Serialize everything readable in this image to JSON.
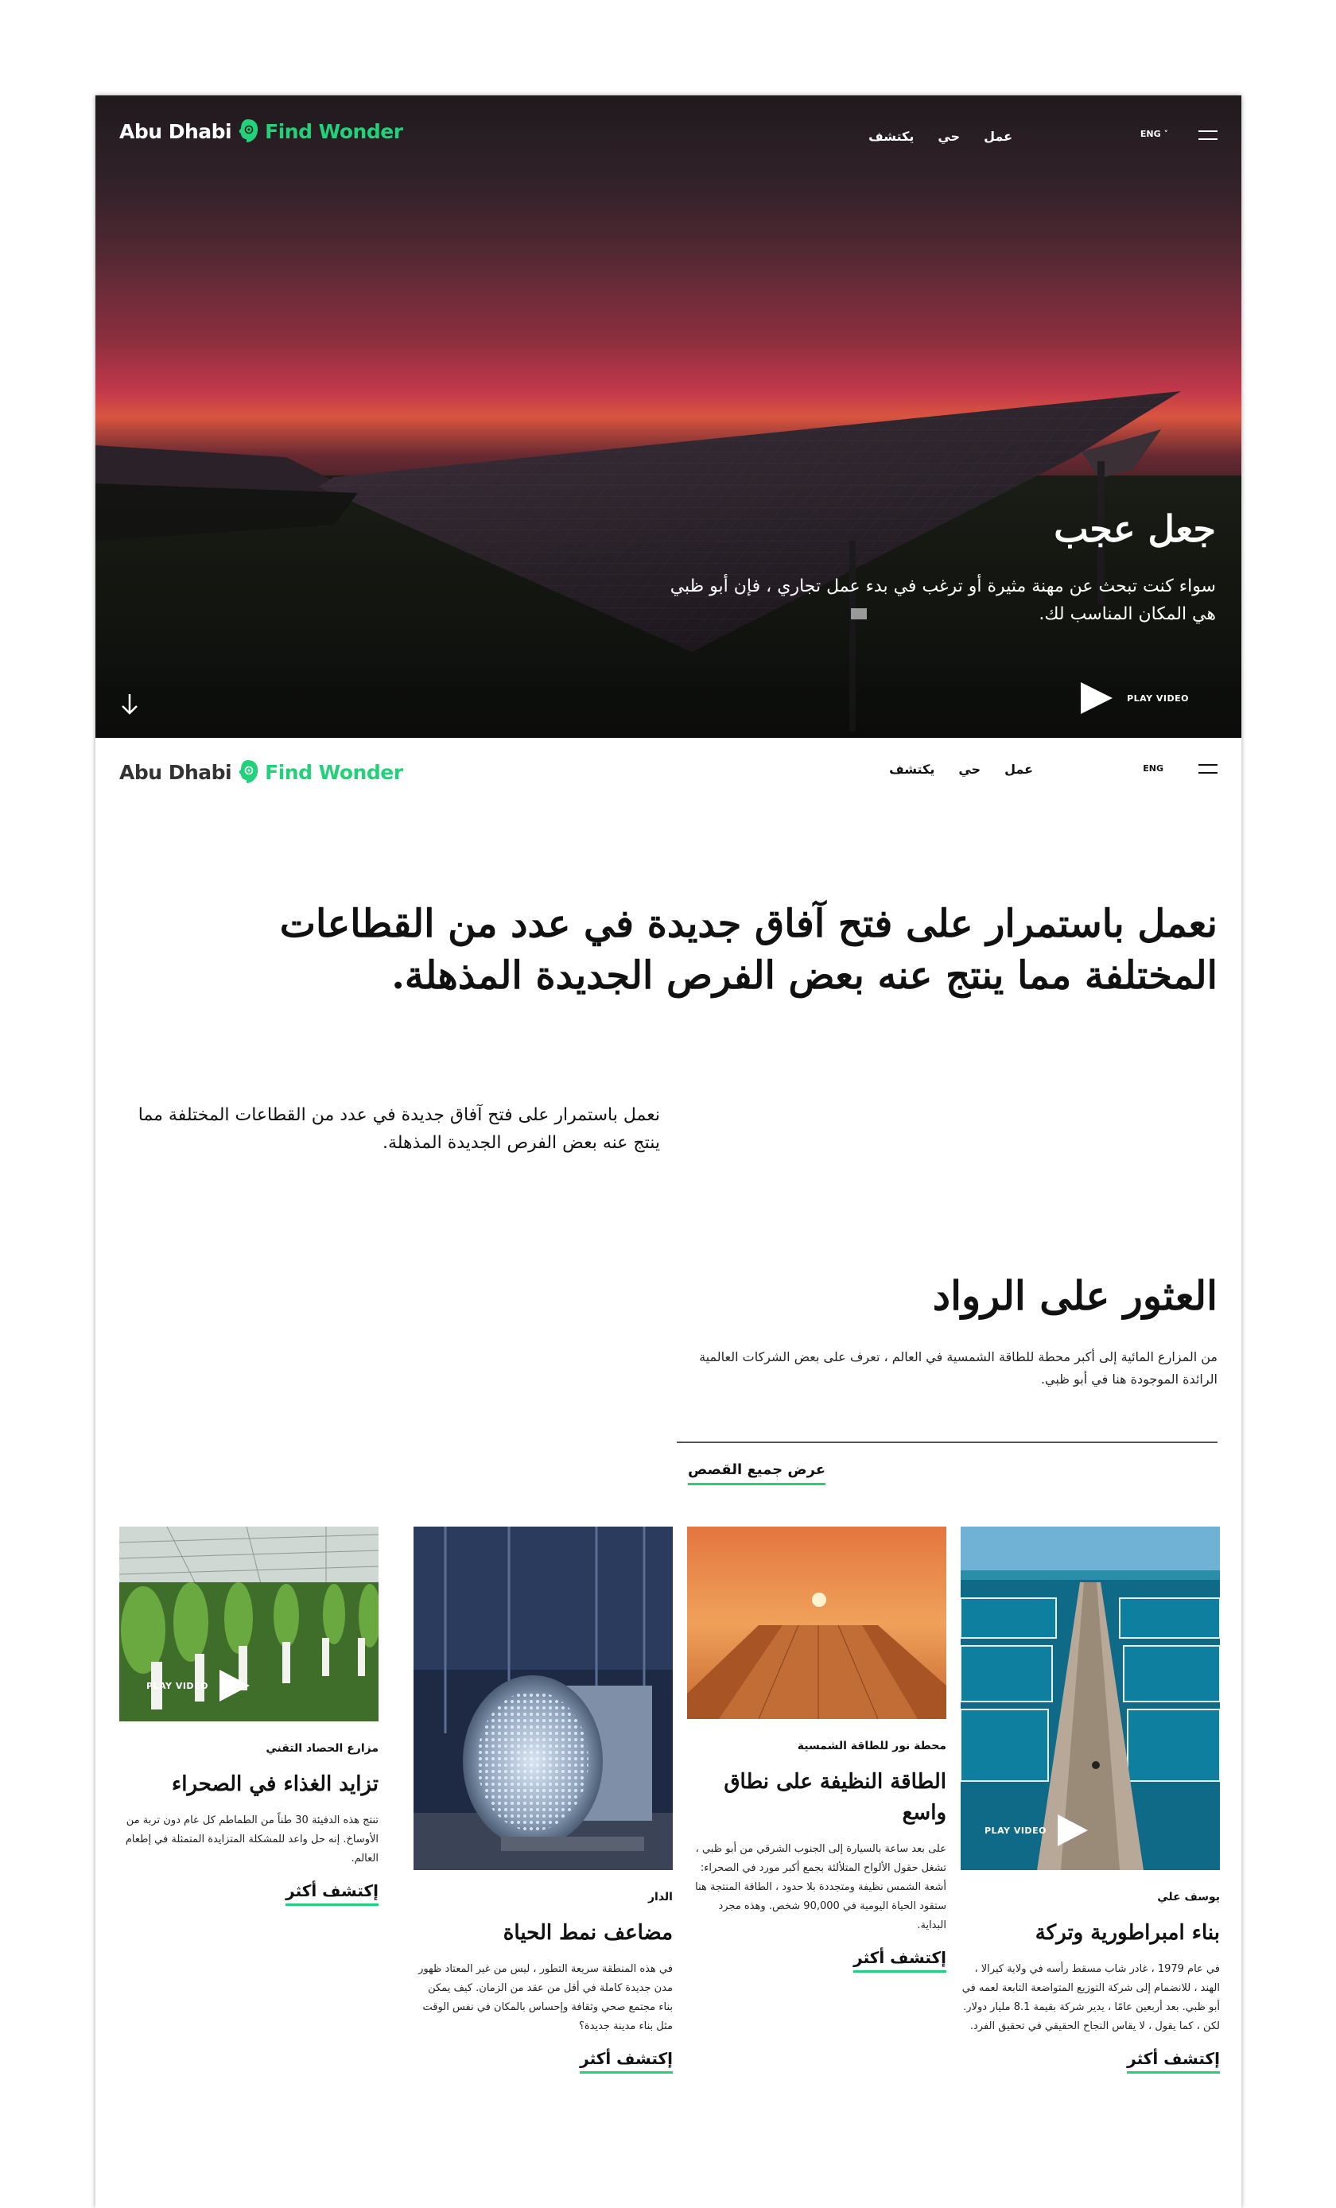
{
  "brand": {
    "name_part1": "Abu Dhabi",
    "name_part2": "Find Wonder"
  },
  "nav": {
    "links": [
      "عمل",
      "حي",
      "يكتشف"
    ],
    "lang": "ENG ˅"
  },
  "nav2": {
    "lang": "ENG"
  },
  "hero": {
    "title": "جعل عجب",
    "subtitle": "سواء كنت تبحث عن مهنة مثيرة أو ترغب في بدء عمل تجاري ، فإن أبو ظبي هي المكان المناسب لك.",
    "play_label": "PLAY VIDEO"
  },
  "lead": "نعمل باستمرار على فتح آفاق جديدة في عدد من القطاعات المختلفة مما ينتج عنه بعض الفرص الجديدة المذهلة.",
  "intro": "نعمل باستمرار على فتح آفاق جديدة في عدد من القطاعات المختلفة مما ينتج عنه بعض الفرص الجديدة المذهلة.",
  "section": {
    "title": "العثور على الرواد",
    "description": "من المزارع المائية إلى أكبر محطة للطاقة الشمسية في العالم ، تعرف على بعض الشركات العالمية الرائدة الموجودة هنا في أبو ظبي.",
    "all_link": "عرض جميع القصص"
  },
  "cards": [
    {
      "category": "يوسف علي",
      "title": "بناء امبراطورية وتركة",
      "body": "في عام 1979 ، غادر شاب مسقط رأسه في ولاية كيرالا ، الهند ، للانضمام إلى شركة التوزيع المتواضعة التابعة لعمه في أبو ظبي. بعد أربعين عامًا ، يدير شركة بقيمة 8.1 مليار دولار. لكن ، كما يقول ، لا يقاس النجاح الحقيقي في تحقيق الفرد.",
      "more": "إكتشف أكثر",
      "play_label": "PLAY VIDEO"
    },
    {
      "category": "محطة نور للطاقة الشمسية",
      "title": "الطاقة النظيفة على نطاق واسع",
      "body": "على بعد ساعة بالسيارة إلى الجنوب الشرقي من أبو ظبي ، تشغل حقول الألواح المتلألئة بجمع أكبر مورد في الصحراء: أشعة الشمس نظيفة ومتجددة بلا حدود ، الطاقة المنتجة هنا ستقود الحياة اليومية في 90,000 شخص. وهذه مجرد البداية.",
      "more": "إكتشف أكثر"
    },
    {
      "category": "الدار",
      "title": "مضاعف نمط الحياة",
      "body": "في هذه المنطقة سريعة التطور ، ليس من غير المعتاد ظهور مدن جديدة كاملة في أقل من عقد من الزمان. كيف يمكن بناء مجتمع صحي وثقافة وإحساس بالمكان في نفس الوقت مثل بناء مدينة جديدة؟",
      "more": "إكتشف أكثر"
    },
    {
      "category": "مزارع الحصاد التقني",
      "title": "تزايد الغذاء في الصحراء",
      "body": "تنتج هذه الدفيئة 30 طناً من الطماطم كل عام دون تربة من الأوساخ. إنه حل واعد للمشكلة المتزايدة المتمثلة في إطعام العالم.",
      "more": "إكتشف أكثر",
      "play_label": "PLAY VIDEO"
    }
  ],
  "colors": {
    "accent": "#22d17a",
    "text": "#111111"
  },
  "icons": {
    "down": "arrow-down-icon",
    "menu": "hamburger-menu-icon",
    "play": "play-icon"
  }
}
